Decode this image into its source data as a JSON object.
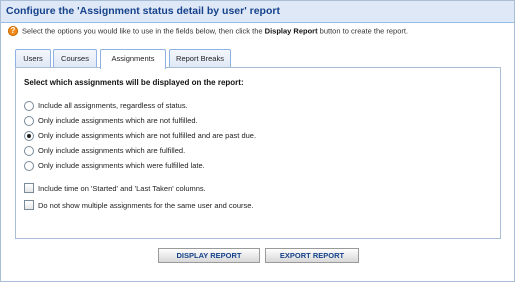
{
  "header": {
    "title": "Configure the 'Assignment status detail by user' report"
  },
  "help": {
    "icon": "help-icon",
    "text_before": "Select the options you would like to use in the fields below, then click the ",
    "text_bold": "Display Report",
    "text_after": " button to create the report."
  },
  "tabs": [
    {
      "label": "Users",
      "active": false
    },
    {
      "label": "Courses",
      "active": false
    },
    {
      "label": "Assignments",
      "active": true
    },
    {
      "label": "Report Breaks",
      "active": false
    }
  ],
  "assignments": {
    "heading": "Select which assignments will be displayed on the report:",
    "options": [
      {
        "label": "Include all assignments, regardless of status.",
        "selected": false
      },
      {
        "label": "Only include assignments which are not fulfilled.",
        "selected": false
      },
      {
        "label": "Only include assignments which are not fulfilled and are past due.",
        "selected": true
      },
      {
        "label": "Only include assignments which are fulfilled.",
        "selected": false
      },
      {
        "label": "Only include assignments which were fulfilled late.",
        "selected": false
      }
    ],
    "checkboxes": [
      {
        "label": "Include time on 'Started' and 'Last Taken' columns.",
        "checked": false
      },
      {
        "label": "Do not show multiple assignments for the same user and course.",
        "checked": false
      }
    ]
  },
  "buttons": {
    "display_label": "DISPLAY REPORT",
    "export_label": "EXPORT REPORT"
  }
}
